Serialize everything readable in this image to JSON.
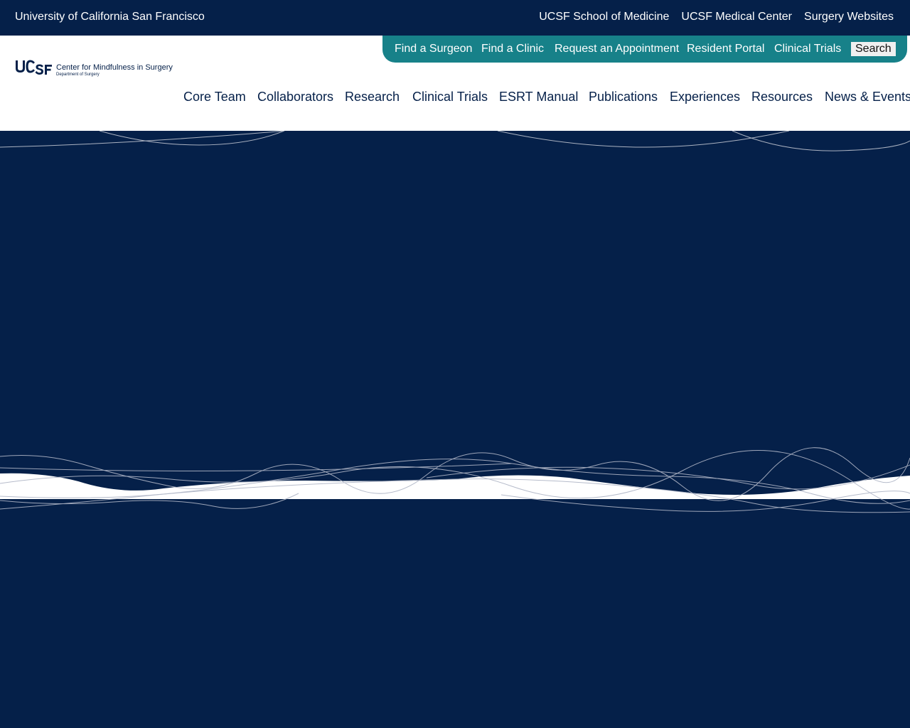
{
  "topbar": {
    "university": "University of California San Francisco",
    "links": [
      "UCSF School of Medicine",
      "UCSF Medical Center",
      "Surgery Websites"
    ]
  },
  "quick_links": {
    "items": [
      "Find a Surgeon",
      "Find a Clinic",
      "Request an Appointment",
      "Resident Portal",
      "Clinical Trials"
    ],
    "search_label": "Search"
  },
  "logo": {
    "wordmark": "UCSF",
    "title": "Center for Mindfulness in Surgery",
    "subtitle": "Department of Surgery"
  },
  "main_nav": {
    "items": [
      "Core Team",
      "Collaborators",
      "Research",
      "Clinical Trials",
      "ESRT Manual",
      "Publications",
      "Experiences",
      "Resources",
      "News & Events"
    ]
  },
  "colors": {
    "navy": "#052049",
    "teal": "#178189",
    "white": "#ffffff"
  }
}
